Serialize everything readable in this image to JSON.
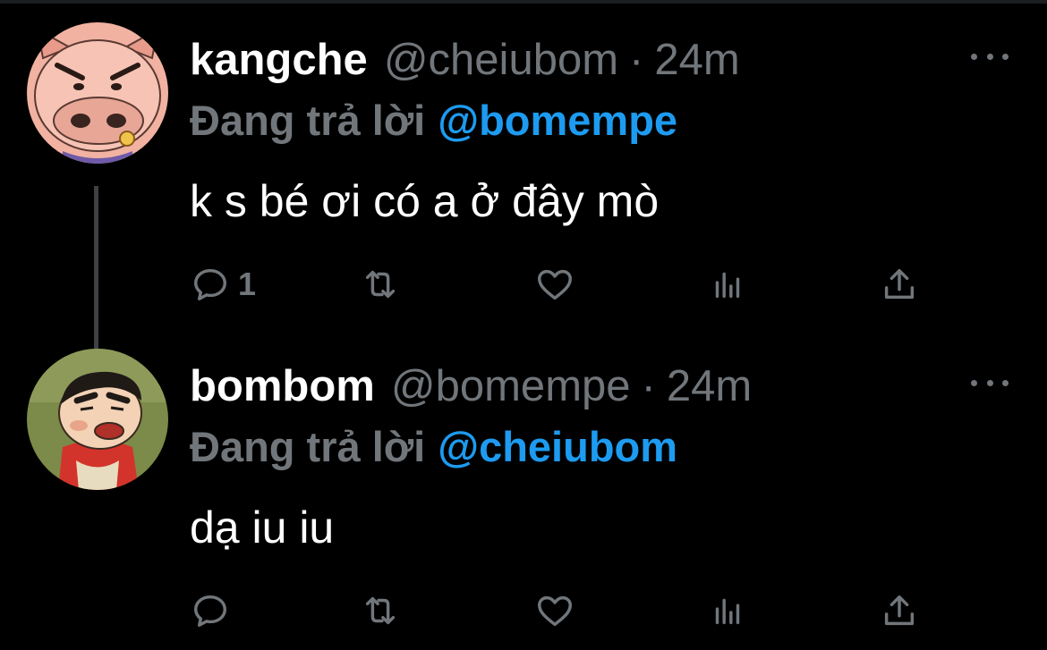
{
  "tweets": [
    {
      "display_name": "kangche",
      "handle": "@cheiubom",
      "separator": "·",
      "time": "24m",
      "reply_prefix": "Đang trả lời",
      "reply_to": "@bomempe",
      "text": "k s bé ơi có a ở đây mò",
      "reply_count": "1",
      "avatar": "pig-cartoon-avatar"
    },
    {
      "display_name": "bombom",
      "handle": "@bomempe",
      "separator": "·",
      "time": "24m",
      "reply_prefix": "Đang trả lời",
      "reply_to": "@cheiubom",
      "text": "dạ iu iu",
      "reply_count": "",
      "avatar": "shinchan-cartoon-avatar"
    }
  ],
  "icons": {
    "reply": "reply-icon",
    "retweet": "retweet-icon",
    "like": "heart-icon",
    "views": "views-icon",
    "share": "share-icon",
    "more": "more-icon"
  },
  "colors": {
    "background": "#000000",
    "text_primary": "#ffffff",
    "text_secondary": "#71767b",
    "mention": "#1d9bf0",
    "thread_line": "#3e4144"
  }
}
